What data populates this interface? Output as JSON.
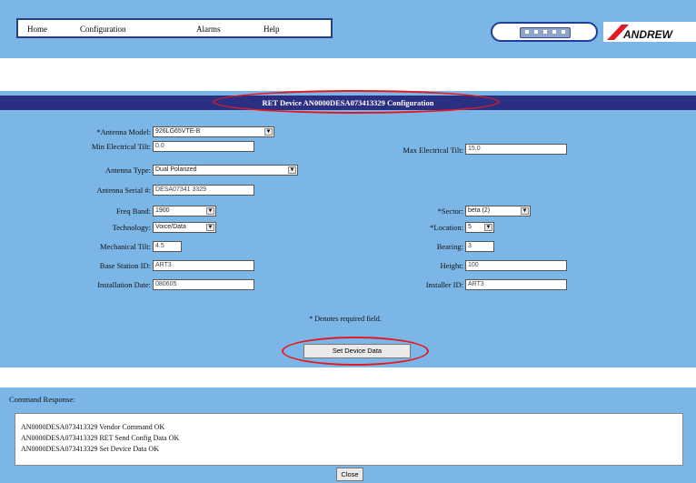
{
  "nav": {
    "items": [
      "Home",
      "Configuration",
      "Alarms",
      "Help"
    ]
  },
  "logo": {
    "brand": "ANDREW"
  },
  "config": {
    "title": "RET Device AN0000DESA073413329 Configuration",
    "fields": {
      "antenna_model": {
        "label": "*Antenna Model:",
        "value": "926LG65VTE-B"
      },
      "min_tilt": {
        "label": "Min Electrical Tilt:",
        "value": "0.0"
      },
      "max_tilt": {
        "label": "Max Electrical Tilt:",
        "value": "15.0"
      },
      "antenna_type": {
        "label": "Antenna Type:",
        "value": "Dual Polarized"
      },
      "antenna_serial": {
        "label": "Antenna Serial #:",
        "value": "DESA07341 3329"
      },
      "freq_band": {
        "label": "Freq Band:",
        "value": "1900"
      },
      "sector": {
        "label": "*Sector:",
        "value": "beta (2)"
      },
      "technology": {
        "label": "Technology:",
        "value": "Voice/Data"
      },
      "location": {
        "label": "*Location:",
        "value": "5"
      },
      "mech_tilt": {
        "label": "Mechanical Tilt:",
        "value": "4.5"
      },
      "bearing": {
        "label": "Bearing:",
        "value": "3"
      },
      "base_station": {
        "label": "Base Station ID:",
        "value": "ART3"
      },
      "height": {
        "label": "Height:",
        "value": "100"
      },
      "install_date": {
        "label": "Installation Date:",
        "value": "080605"
      },
      "installer_id": {
        "label": "Installer ID:",
        "value": "ART3"
      }
    },
    "required_note": "* Denotes required field.",
    "set_button": "Set Device Data"
  },
  "response": {
    "heading": "Command Response:",
    "lines": [
      "AN0000DESA073413329 Vendor Command OK",
      "AN0000DESA073413329 RET Send Config Data OK",
      "AN0000DESA073413329 Set Device Data OK"
    ],
    "close_button": "Close"
  },
  "colors": {
    "background": "#7cb6e6",
    "title_bar": "#2a2f82",
    "highlight_oval": "#e01b24"
  }
}
